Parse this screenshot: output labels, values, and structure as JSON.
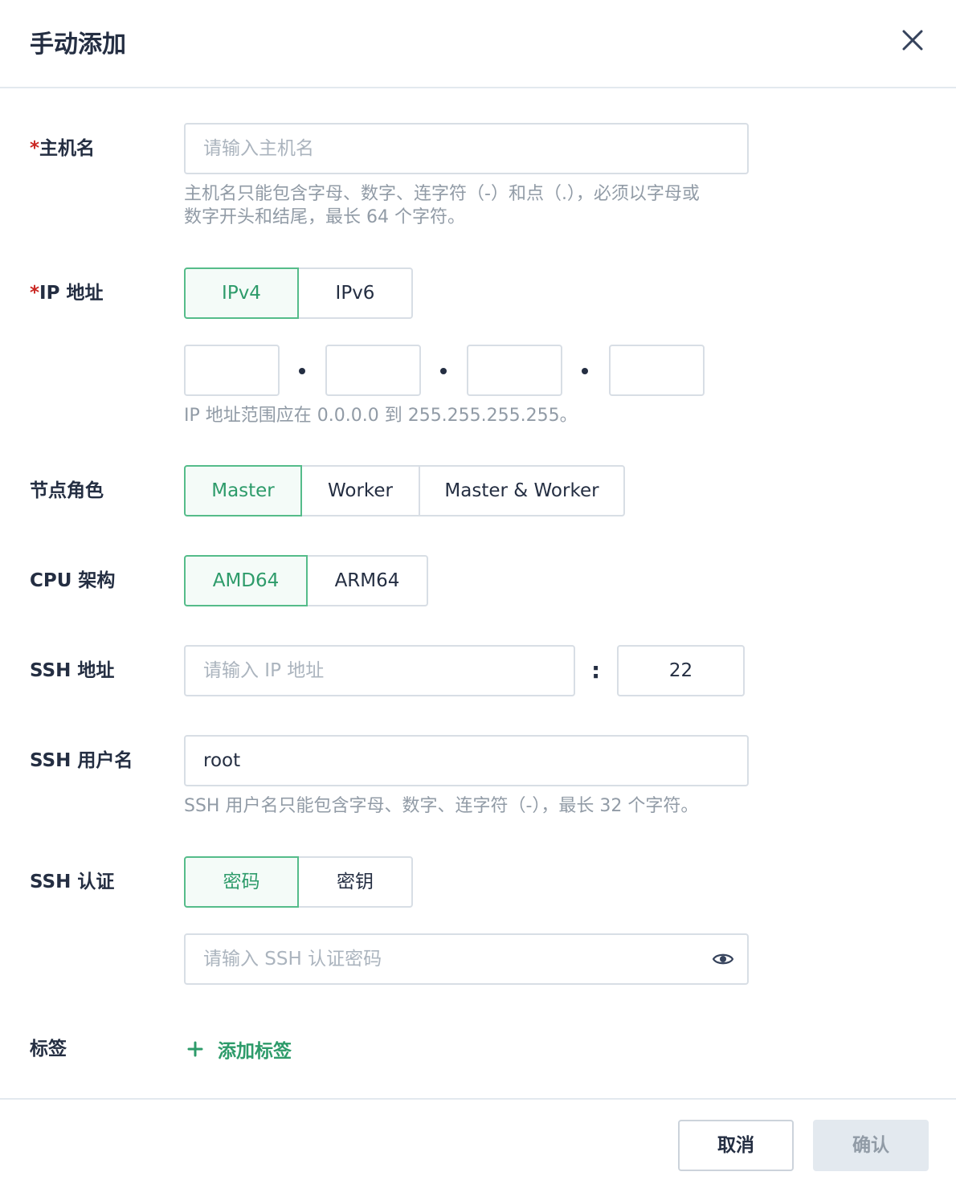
{
  "dialog": {
    "title": "手动添加"
  },
  "hostname": {
    "required_mark": "*",
    "label": "主机名",
    "placeholder": "请输入主机名",
    "hint_line1": "主机名只能包含字母、数字、连字符（-）和点（.），必须以字母或",
    "hint_line2": "数字开头和结尾，最长 64 个字符。"
  },
  "ip": {
    "required_mark": "*",
    "label": "IP 地址",
    "versions": [
      "IPv4",
      "IPv6"
    ],
    "selected": "IPv4",
    "octets": [
      "",
      "",
      "",
      ""
    ],
    "hint": "IP 地址范围应在 0.0.0.0 到 255.255.255.255。"
  },
  "node_role": {
    "label": "节点角色",
    "options": [
      "Master",
      "Worker",
      "Master & Worker"
    ],
    "selected": "Master"
  },
  "cpu_arch": {
    "label": "CPU 架构",
    "options": [
      "AMD64",
      "ARM64"
    ],
    "selected": "AMD64"
  },
  "ssh_address": {
    "label": "SSH 地址",
    "placeholder": "请输入 IP 地址",
    "separator": ":",
    "port": "22"
  },
  "ssh_user": {
    "label": "SSH 用户名",
    "value": "root",
    "hint": "SSH 用户名只能包含字母、数字、连字符（-），最长 32 个字符。"
  },
  "ssh_auth": {
    "label": "SSH 认证",
    "options": [
      "密码",
      "密钥"
    ],
    "selected": "密码",
    "password_placeholder": "请输入 SSH 认证密码",
    "eye_icon": "eye-icon"
  },
  "tags": {
    "label": "标签",
    "add_label": "添加标签"
  },
  "footer": {
    "cancel_label": "取消",
    "confirm_label": "确认"
  },
  "colors": {
    "accent": "#55bc8a",
    "accent_text": "#2d9b6a",
    "required": "#ca2621",
    "border": "#d8dee5",
    "hint": "#919ba6"
  }
}
